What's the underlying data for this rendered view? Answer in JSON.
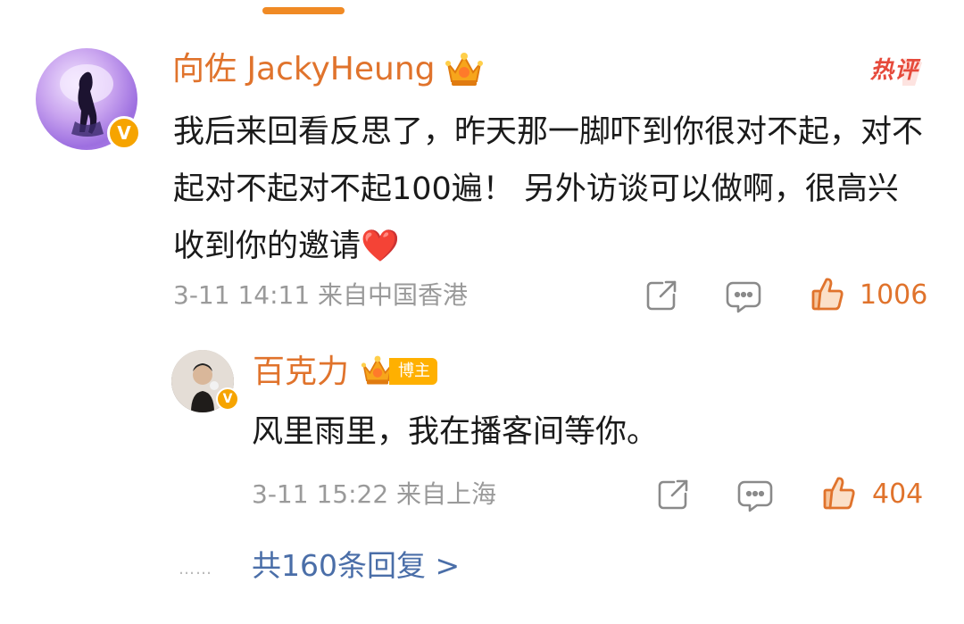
{
  "comment": {
    "username": "向佐 JackyHeung",
    "hot_label": "热评",
    "text": "我后来回看反思了，昨天那一脚吓到你很对不起，对不起对不起对不起100遍！ 另外访谈可以做啊，很高兴收到你的邀请",
    "heart_emoji": "❤️",
    "meta": "3-11 14:11 来自中国香港",
    "like_count": "1006",
    "verified_badge": "V"
  },
  "reply": {
    "username": "百克力",
    "blogger_tag": "博主",
    "text": "风里雨里，我在播客间等你。",
    "meta": "3-11 15:22 来自上海",
    "like_count": "404",
    "verified_badge": "V"
  },
  "thread": {
    "dots": "……",
    "more_replies": "共160条回复 >"
  },
  "icons": {
    "share": "share-icon",
    "comment": "comment-icon",
    "like": "thumbs-up-icon",
    "crown": "crown-icon"
  },
  "colors": {
    "username": "#e0732c",
    "link": "#4a6ea8",
    "meta": "#9a9a9a",
    "hot": "#e64a3b",
    "verified": "#f6a400",
    "accent": "#f08a24"
  }
}
